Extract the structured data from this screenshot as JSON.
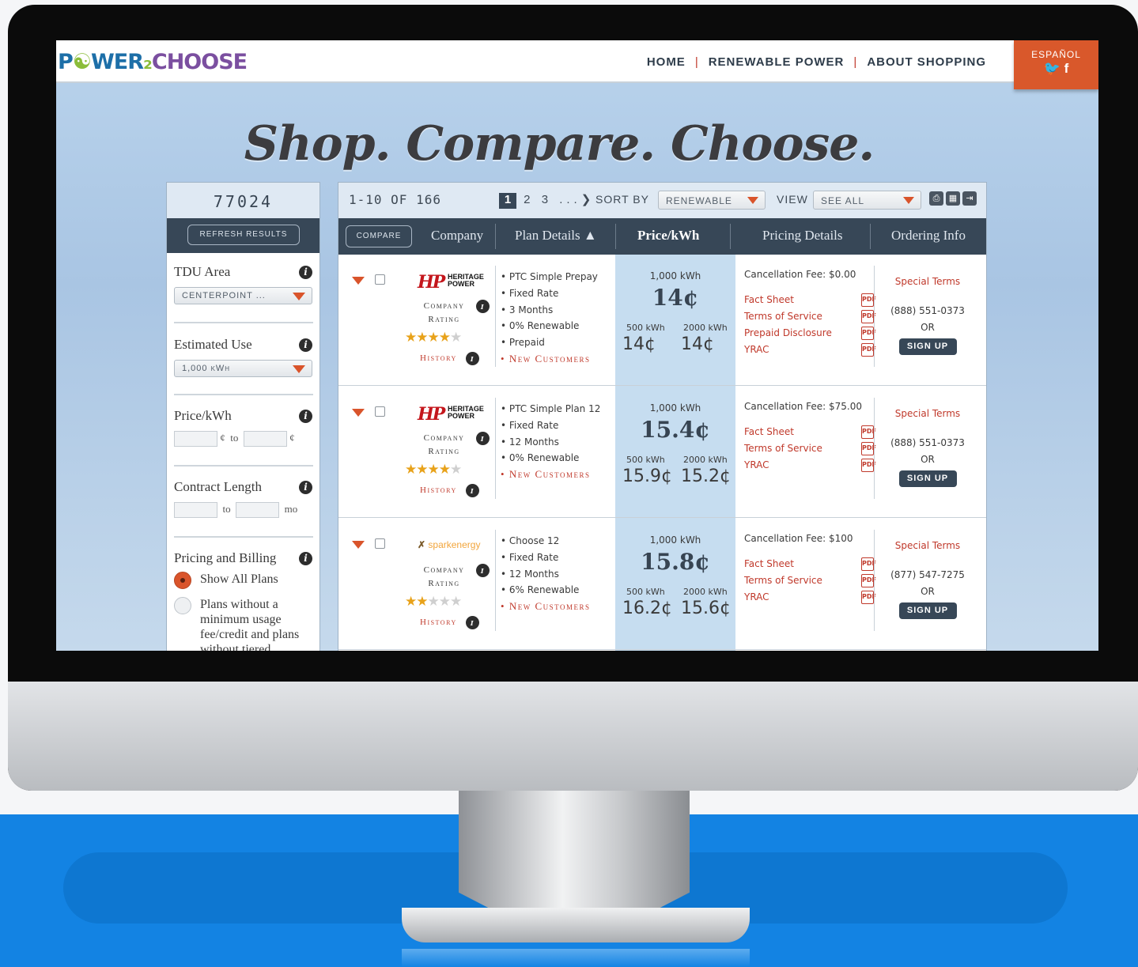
{
  "colors": {
    "accent": "#d9542b",
    "navy": "#374757",
    "price_column": "#c6ddf0",
    "link_red": "#c0392b",
    "star": "#e8a21a"
  },
  "site": {
    "logo_parts": [
      "P",
      "☯",
      "WER",
      "₂",
      "CHOOSE"
    ],
    "logo_icon": "power-plug-icon",
    "nav": [
      "HOME",
      "RENEWABLE POWER",
      "ABOUT SHOPPING"
    ],
    "nav_sep": "|",
    "espanol": "ESPAÑOL",
    "social": [
      "twitter-icon",
      "facebook-icon"
    ],
    "headline": "Shop. Compare. Choose."
  },
  "sidebar": {
    "zip": "77024",
    "refresh": "REFRESH RESULTS",
    "tdu_title": "TDU Area",
    "tdu_value": "CENTERPOINT ...",
    "use_title": "Estimated Use",
    "use_value": "1,000 kWh",
    "price_title": "Price/kWh",
    "price_unit": "¢",
    "to": "to",
    "contract_title": "Contract Length",
    "contract_unit": "mo",
    "billing_title": "Pricing and Billing",
    "billing_options": [
      "Show All Plans",
      "Plans without a minimum usage fee/credit and plans without tiered"
    ],
    "billing_selected": 0,
    "info_glyph": "i"
  },
  "results": {
    "count": "1-10 OF 166",
    "pages": [
      "1",
      "2",
      "3",
      "...",
      "❯"
    ],
    "current_page": "1",
    "sort_label": "SORT BY",
    "sort_value": "RENEWABLE",
    "view_label": "VIEW",
    "view_value": "SEE ALL",
    "tools": [
      "print-icon",
      "excel-icon",
      "export-icon"
    ],
    "compare": "COMPARE",
    "columns": [
      "Company",
      "Plan Details ▲",
      "Price/kWh",
      "Pricing Details",
      "Ordering Info"
    ],
    "company_rating": "Company Rating",
    "history": "History",
    "rows": [
      {
        "logo": "HERITAGE POWER",
        "logo_mark": "HP",
        "rating": 4,
        "plan": [
          "PTC Simple Prepay",
          "Fixed Rate",
          "3 Months",
          "0% Renewable",
          "Prepaid"
        ],
        "new_customers": "New Customers",
        "price_1000_label": "1,000 kWh",
        "price_1000": "14¢",
        "price_500_label": "500 kWh",
        "price_500": "14¢",
        "price_2000_label": "2000 kWh",
        "price_2000": "14¢",
        "cancellation": "Cancellation Fee: $0.00",
        "docs": [
          "Fact Sheet",
          "Terms of Service",
          "Prepaid Disclosure",
          "YRAC"
        ],
        "special": "Special Terms",
        "phone": "(888) 551-0373",
        "or": "OR",
        "signup": "SIGN UP"
      },
      {
        "logo": "HERITAGE POWER",
        "logo_mark": "HP",
        "rating": 4,
        "plan": [
          "PTC Simple Plan 12",
          "Fixed Rate",
          "12 Months",
          "0% Renewable"
        ],
        "new_customers": "New Customers",
        "price_1000_label": "1,000 kWh",
        "price_1000": "15.4¢",
        "price_500_label": "500 kWh",
        "price_500": "15.9¢",
        "price_2000_label": "2000 kWh",
        "price_2000": "15.2¢",
        "cancellation": "Cancellation Fee: $75.00",
        "docs": [
          "Fact Sheet",
          "Terms of Service",
          "YRAC"
        ],
        "special": "Special Terms",
        "phone": "(888) 551-0373",
        "or": "OR",
        "signup": "SIGN UP"
      },
      {
        "logo": "sparkenergy",
        "logo_mark": "✗",
        "rating": 2,
        "plan": [
          "Choose 12",
          "Fixed Rate",
          "12 Months",
          "6% Renewable"
        ],
        "new_customers": "New Customers",
        "price_1000_label": "1,000 kWh",
        "price_1000": "15.8¢",
        "price_500_label": "500 kWh",
        "price_500": "16.2¢",
        "price_2000_label": "2000 kWh",
        "price_2000": "15.6¢",
        "cancellation": "Cancellation Fee: $100",
        "docs": [
          "Fact Sheet",
          "Terms of Service",
          "YRAC"
        ],
        "special": "Special Terms",
        "phone": "(877) 547-7275",
        "or": "OR",
        "signup": "SIGN UP"
      }
    ]
  }
}
